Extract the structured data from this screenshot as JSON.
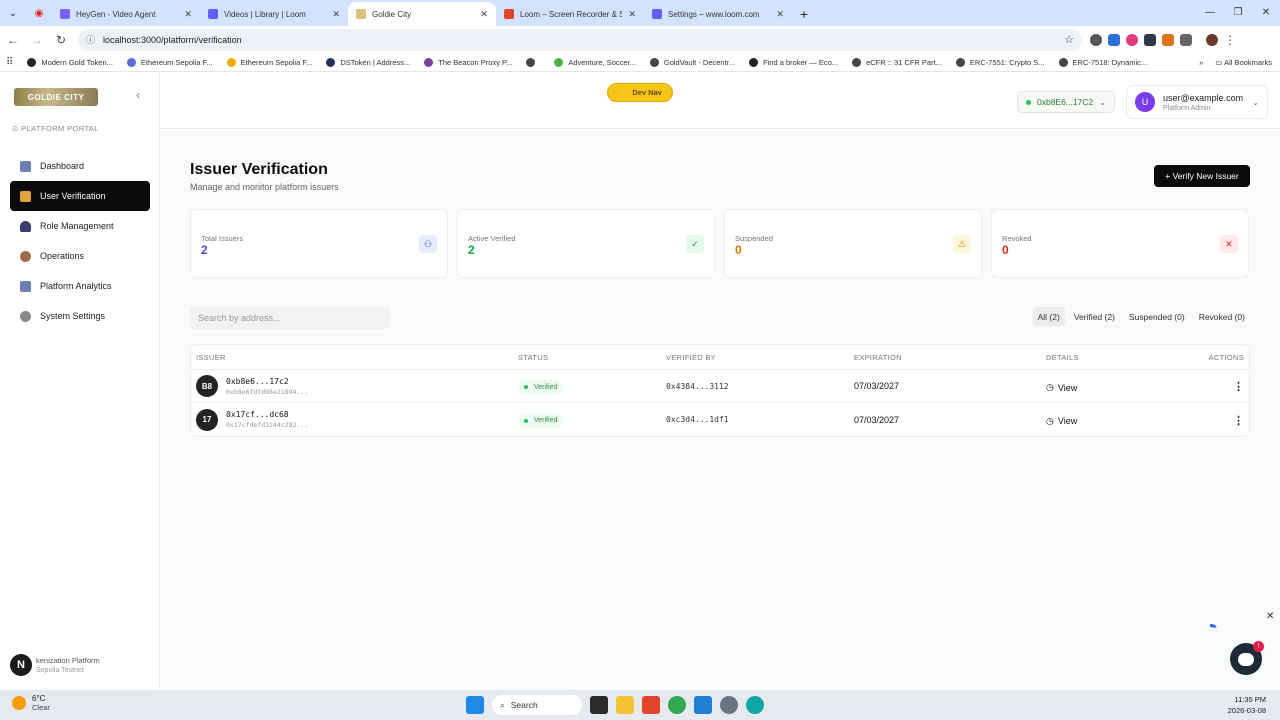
{
  "browser": {
    "tabs": [
      {
        "title": "HeyGen - Video Agent",
        "color": "#7b61ff",
        "active": false
      },
      {
        "title": "Videos | Library | Loom",
        "color": "#625df5",
        "active": false
      },
      {
        "title": "Goldie City",
        "color": "#d9c27a",
        "active": true
      },
      {
        "title": "Loom – Screen Recorder & Scre",
        "color": "#e0452b",
        "active": false
      },
      {
        "title": "Settings – www.loom.com",
        "color": "#625df5",
        "active": false
      }
    ],
    "url": "localhost:3000/platform/verification",
    "bookmarks": [
      "Modern Gold Token...",
      "Ethereum Sepolia F...",
      "Ethereum Sepolia F...",
      "DSToken | Address...",
      "The Beacon Proxy P...",
      "",
      "Adventure, Soccer...",
      "GoldVault - Decentr...",
      "Find a broker — Eco...",
      "eCFR :: 31 CFR Part...",
      "ERC-7551: Crypto S...",
      "ERC-7518: Dynamic..."
    ],
    "all_bookmarks": "All Bookmarks"
  },
  "sidebar": {
    "logo": "GOLDIE CITY",
    "portal_label": "PLATFORM PORTAL",
    "items": [
      {
        "label": "Dashboard",
        "icon": "chart-bar-icon",
        "color": "#6b7fb0"
      },
      {
        "label": "User Verification",
        "icon": "shield-check-icon",
        "color": "#e2a33c"
      },
      {
        "label": "Role Management",
        "icon": "user-icon",
        "color": "#3b3b6d"
      },
      {
        "label": "Operations",
        "icon": "stopwatch-icon",
        "color": "#9c6b4a"
      },
      {
        "label": "Platform Analytics",
        "icon": "trend-chart-icon",
        "color": "#6b7fb0"
      },
      {
        "label": "System Settings",
        "icon": "gear-icon",
        "color": "#8a8a8a"
      }
    ],
    "footer_line1": "kenization Platform",
    "footer_line2": "Sepolia Testnet",
    "footer_avatar": "N"
  },
  "topbar": {
    "dev_nav": "Dev Nav",
    "wallet": "0xb8E6...17C2",
    "user_email": "user@example.com",
    "user_role": "Platform Admin",
    "user_initial": "U"
  },
  "page": {
    "title": "Issuer Verification",
    "subtitle": "Manage and monitor platform issuers",
    "verify_button": "+ Verify New Issuer",
    "search_placeholder": "Search by address...",
    "stats": [
      {
        "label": "Total Issuers",
        "value": "2",
        "color": "#4f46e5",
        "icon_bg": "#e8ecff",
        "icon": "users-icon",
        "glyph": "⚇"
      },
      {
        "label": "Active Verified",
        "value": "2",
        "color": "#16a34a",
        "icon_bg": "#e7f8ec",
        "icon": "check-circle-icon",
        "glyph": "✓"
      },
      {
        "label": "Suspended",
        "value": "0",
        "color": "#d97706",
        "icon_bg": "#fdf6d8",
        "icon": "warning-icon",
        "glyph": "⚠"
      },
      {
        "label": "Revoked",
        "value": "0",
        "color": "#dc2626",
        "icon_bg": "#fde8ea",
        "icon": "x-circle-icon",
        "glyph": "✕"
      }
    ],
    "filters": [
      {
        "label": "All (2)",
        "active": true
      },
      {
        "label": "Verified (2)",
        "active": false
      },
      {
        "label": "Suspended (0)",
        "active": false
      },
      {
        "label": "Revoked (0)",
        "active": false
      }
    ],
    "table": {
      "headers": [
        "ISSUER",
        "STATUS",
        "VERIFIED BY",
        "EXPIRATION",
        "DETAILS",
        "ACTIONS"
      ],
      "rows": [
        {
          "avatar": "B8",
          "address": "0xb8e6...17c2",
          "full": "0xb8e6fdfd98e21894...",
          "status": "Verified",
          "verified_by": "0x4384...3112",
          "expiration": "07/03/2027",
          "details": "View"
        },
        {
          "avatar": "17",
          "address": "0x17cf...dc68",
          "full": "0x17cfdefd3244c292...",
          "status": "Verified",
          "verified_by": "0xc3d4...1df1",
          "expiration": "07/03/2027",
          "details": "View"
        }
      ]
    }
  },
  "taskbar": {
    "temp": "6°C",
    "weather": "Clear",
    "search": "Search",
    "time": "11:35 PM",
    "date": "2026-03-08"
  }
}
